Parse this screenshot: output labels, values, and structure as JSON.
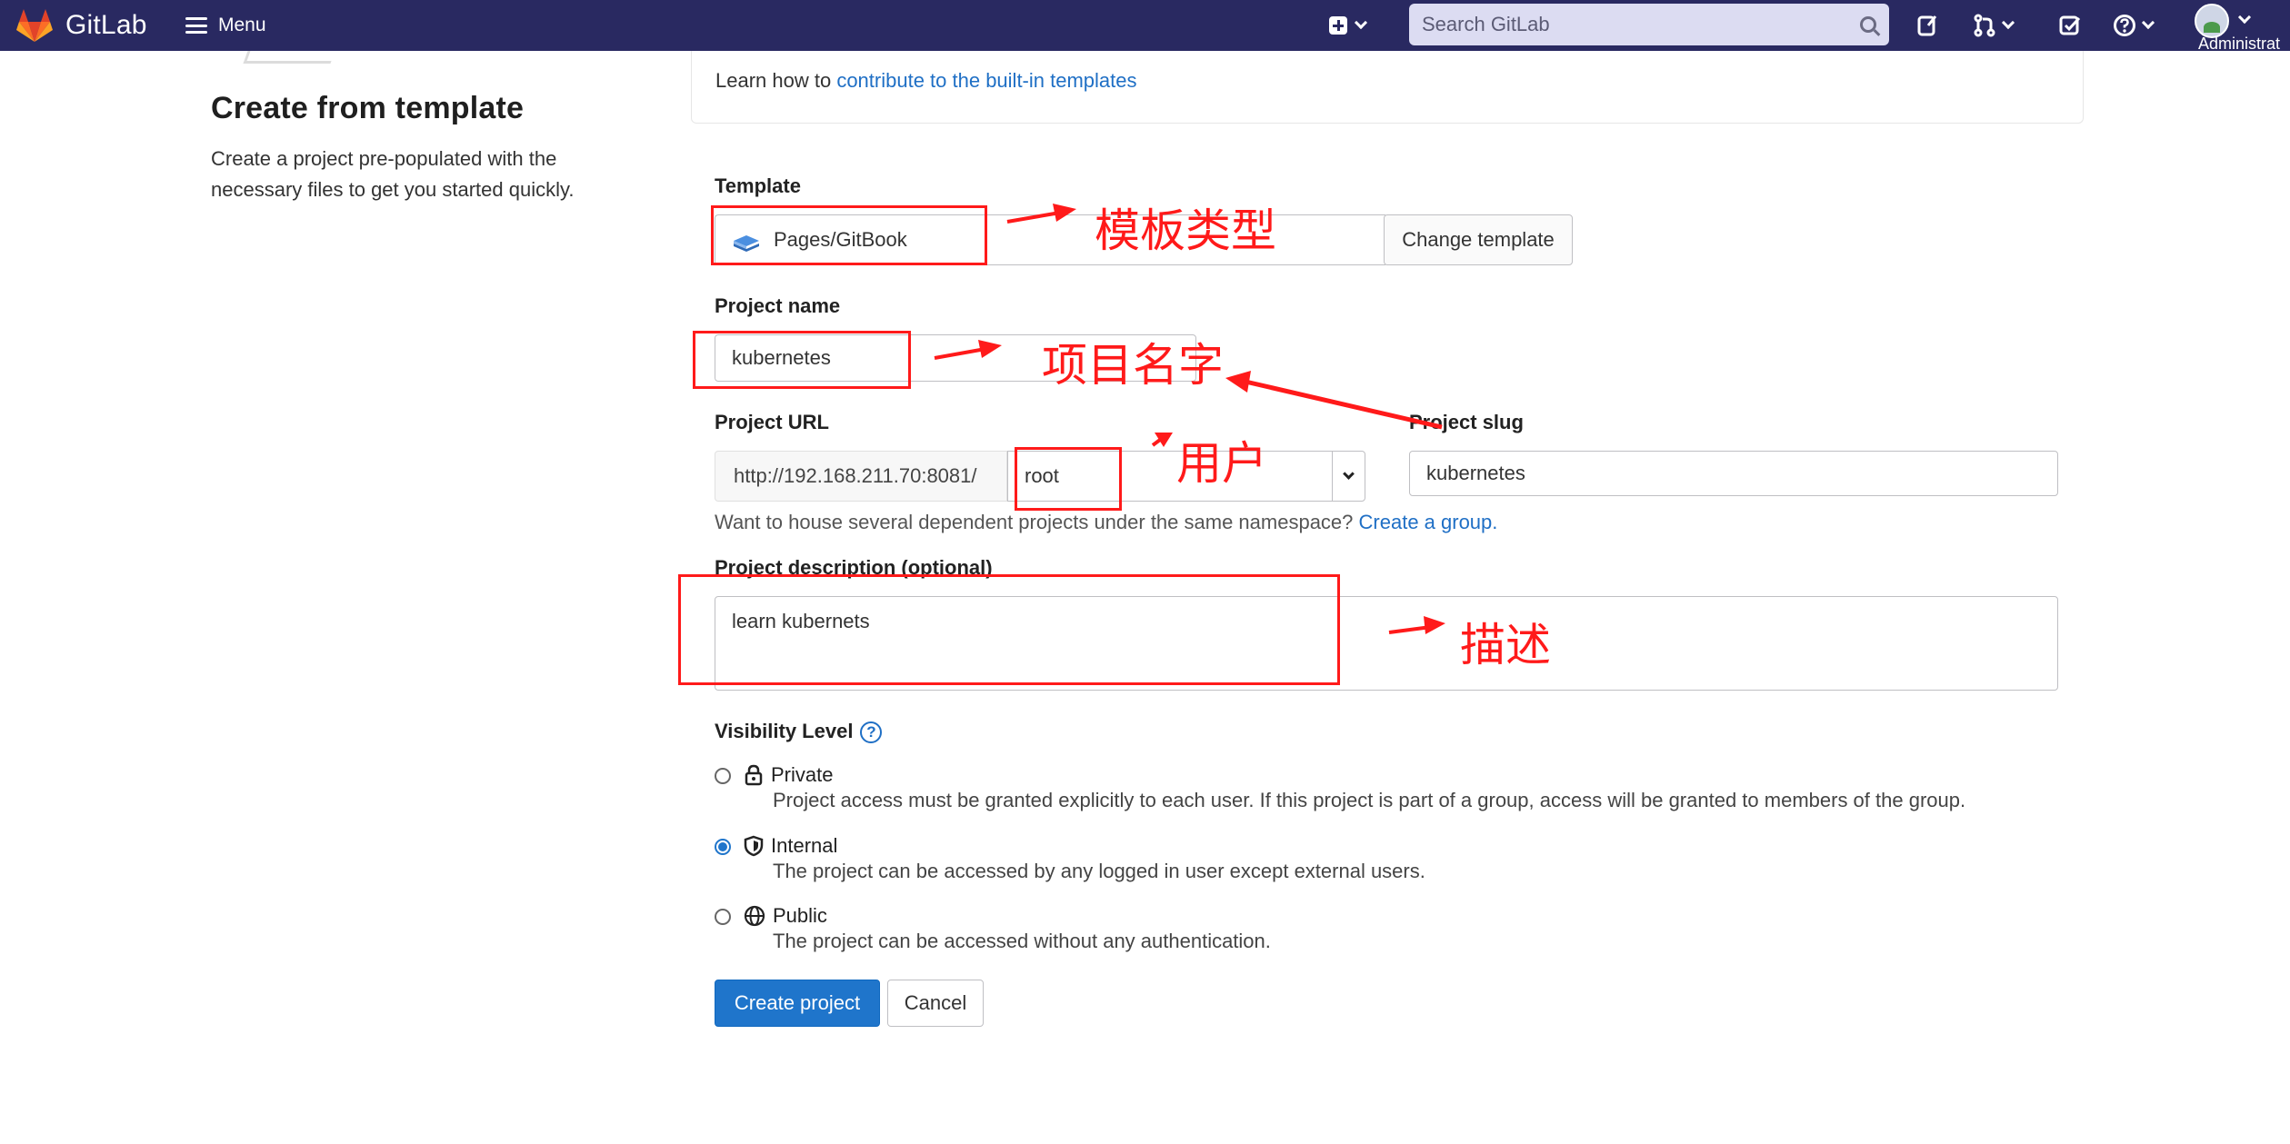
{
  "navbar": {
    "brand_name": "GitLab",
    "menu_label": "Menu",
    "search_placeholder": "Search GitLab",
    "user_label": "Administrat"
  },
  "left_panel": {
    "title": "Create from template",
    "description": "Create a project pre-populated with the necessary files to get you started quickly."
  },
  "learn_box": {
    "prefix": "Learn how to ",
    "link": "contribute to the built-in templates"
  },
  "form": {
    "template_label": "Template",
    "template_value": "Pages/GitBook",
    "change_template_label": "Change template",
    "project_name_label": "Project name",
    "project_name_value": "kubernetes",
    "project_url_label": "Project URL",
    "url_prefix": "http://192.168.211.70:8081/",
    "namespace_value": "root",
    "project_slug_label": "Project slug",
    "project_slug_value": "kubernetes",
    "hint_text": "Want to house several dependent projects under the same namespace? ",
    "hint_link": "Create a group.",
    "description_label": "Project description (optional)",
    "description_value": "learn kubernets",
    "visibility_label": "Visibility Level",
    "visibility_help": "?",
    "visibility_options": [
      {
        "title": "Private",
        "description": "Project access must be granted explicitly to each user. If this project is part of a group, access will be granted to members of the group.",
        "checked": false
      },
      {
        "title": "Internal",
        "description": "The project can be accessed by any logged in user except external users.",
        "checked": true
      },
      {
        "title": "Public",
        "description": "The project can be accessed without any authentication.",
        "checked": false
      }
    ],
    "create_label": "Create project",
    "cancel_label": "Cancel"
  },
  "annotations": {
    "template_type": "模板类型",
    "project_name": "项目名字",
    "user": "用户",
    "description": "描述",
    "color": "#ff1a1a"
  },
  "colors": {
    "navbar": "#292961",
    "primary": "#1f75cb",
    "link": "#1f6fc5"
  }
}
